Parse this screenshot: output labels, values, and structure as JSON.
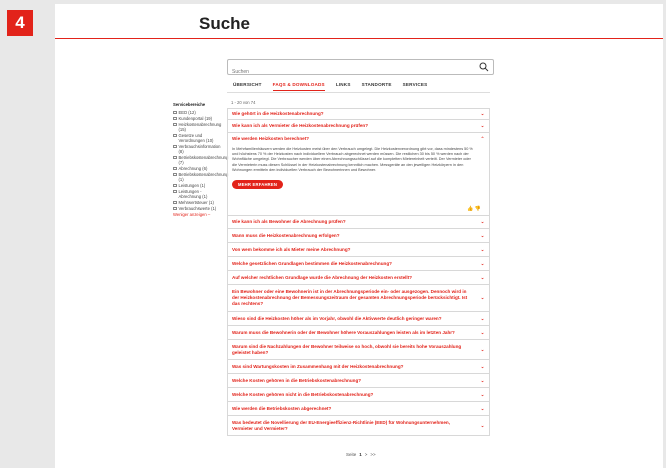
{
  "step_number": "4",
  "title": "Suche",
  "search": {
    "placeholder": "Suchen"
  },
  "tabs": [
    {
      "label": "ÜBERSICHT"
    },
    {
      "label": "FAQS & DOWNLOADS"
    },
    {
      "label": "LINKS"
    },
    {
      "label": "STANDORTE"
    },
    {
      "label": "SERVICES"
    }
  ],
  "sidebar": {
    "title": "Servicebereiche",
    "filters": [
      "EED (12)",
      "Kundenportal (19)",
      "Heizkostenabrechnung (15)",
      "Gesetze und Verordnungen (10)",
      "Verbrauchsinformation (8)",
      "Betriebskostenabrechnung (7)",
      "Abrechnung (6)",
      "Betriebskostenabrechnung (1)",
      "Leistungen (1)",
      "Leistungen - Abrechnung (1)",
      "Mehrwertsteuer (1)",
      "Verbrauchswerte (1)"
    ],
    "more_link": "Weniger anzeigen –"
  },
  "result_count": "1 - 20 von 74",
  "faq_before": [
    "Wie gehört in die Heizkostenabrechnung?",
    "Wie kann ich als Vermieter die Heizkostenabrechnung prüfen?"
  ],
  "faq_open": {
    "question": "Wie werden Heizkosten berechnet?",
    "answer": "In Mehrfamilienhäusern werden die Heizkosten meist über den Verbrauch umgelegt. Die Heizkostenverordnung gibt vor, dass mindestens 50 % und höchstens 70 % der Heizkosten nach individuellem Verbrauch abgerechnet werden müssen. Die restlichen 30 bis 50 % werden nach der Wohnfläche umgelegt. Die Verbraucher werden über einen Abrechnungsschlüssel auf die kompletten Mietereinheit verteilt. Der Vermieter oder die Vermieterin muss diesen Schlüssel in der Heizkostenabrechnung kenntlich machen. Messgeräte an den jeweiligen Heizkörpern in den Wohnungen ermitteln den individuellen Verbrauch der Bewohnerinnen und Bewohner.",
    "button": "MEHR ERFAHREN",
    "feedback": "👍 👎"
  },
  "faq_after": [
    "Wie kann ich als Bewohner die Abrechnung prüfen?",
    "Wann muss die Heizkostenabrechnung erfolgen?",
    "Von wem bekomme ich als Mieter meine Abrechnung?",
    "Welche gesetzlichen Grundlagen bestimmen die Heizkostenabrechnung?",
    "Auf welcher rechtlichen Grundlage wurde die Abrechnung der Heizkosten erstellt?",
    "Ein Bewohner oder eine Bewohnerin ist in der Abrechnungsperiode ein- oder ausgezogen. Dennoch wird in der Heizkostenabrechnung der Bemessungszeitraum der gesamten Abrechnungsperiode berücksichtigt. Ist das rechtens?",
    "Wieso sind die Heizkosten höher als im Vorjahr, obwohl die Aktivwerte deutlich geringer waren?",
    "Warum muss die Bewohnerin oder der Bewohner höhere Vorauszahlungen leisten als im letzten Jahr?",
    "Warum sind die Nachzahlungen der Bewohner teilweise so hoch, obwohl sie bereits hohe Vorauszahlung geleistet haben?",
    "Was sind Wartungskosten im Zusammenhang mit der Heizkostenabrechnung?",
    "Welche Kosten gehören in die Betriebskostenabrechnung?",
    "Welche Kosten gehören nicht in die Betriebskostenabrechnung?",
    "Wie werden die Betriebskosten abgerechnet?",
    "Was bedeutet die Novellierung der EU-Energieeffizienz-Richtlinie (EED) für Wohnungsunternehmen, Vermieter und Vermieter?"
  ],
  "pager": {
    "label": "Seite",
    "current": "1",
    "next": ">",
    "last": ">>"
  }
}
